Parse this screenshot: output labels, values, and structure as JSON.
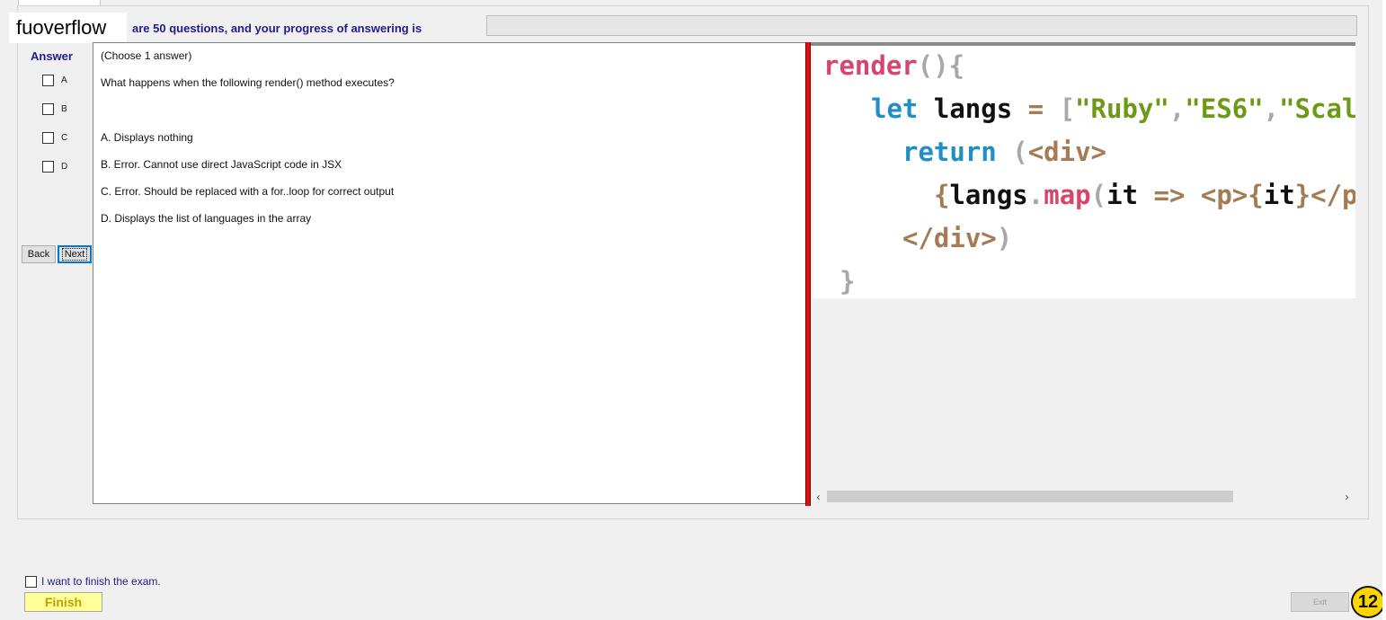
{
  "header": {
    "logo": "fuoverflow",
    "progress_text": "are 50 questions, and your progress of answering is",
    "progress_fraction": 0
  },
  "answer": {
    "title": "Answer",
    "options": [
      "A",
      "B",
      "C",
      "D"
    ]
  },
  "nav": {
    "back_label": "Back",
    "next_label": "Next"
  },
  "question": {
    "instruction": "(Choose 1 answer)",
    "text": "What happens when the following render() method executes?",
    "choices": [
      "A.  Displays nothing",
      "B.  Error. Cannot use direct JavaScript code in JSX",
      "C.  Error. Should be replaced with a for..loop for correct output",
      "D.  Displays the list of languages in the array"
    ]
  },
  "code": {
    "line1": {
      "name": "render",
      "punct": "(){"
    },
    "line2": {
      "kw": "let",
      "var": "langs",
      "op": "=",
      "open": "[",
      "s1": "\"Ruby\"",
      "c1": ",",
      "s2": "\"ES6\"",
      "c2": ",",
      "s3": "\"Scal"
    },
    "line3": {
      "kw": "return",
      "paren": "(",
      "tag": "<div>"
    },
    "line4": {
      "brace": "{",
      "var": "langs",
      "dot": ".",
      "fn": "map",
      "paren": "(",
      "arg": "it",
      "arrow": "=>",
      "tag1": "<p>",
      "b2": "{",
      "arg2": "it",
      "b3": "}",
      "tag2": "</p"
    },
    "line5": {
      "tag": "</div>",
      "paren": ")"
    },
    "line6": {
      "brace": "}"
    }
  },
  "scroll": {
    "left_arrow": "‹",
    "right_arrow": "›"
  },
  "footer": {
    "finish_check_label": "I want to finish the exam.",
    "finish_label": "Finish",
    "exit_label": "Exit",
    "badge": "12"
  }
}
